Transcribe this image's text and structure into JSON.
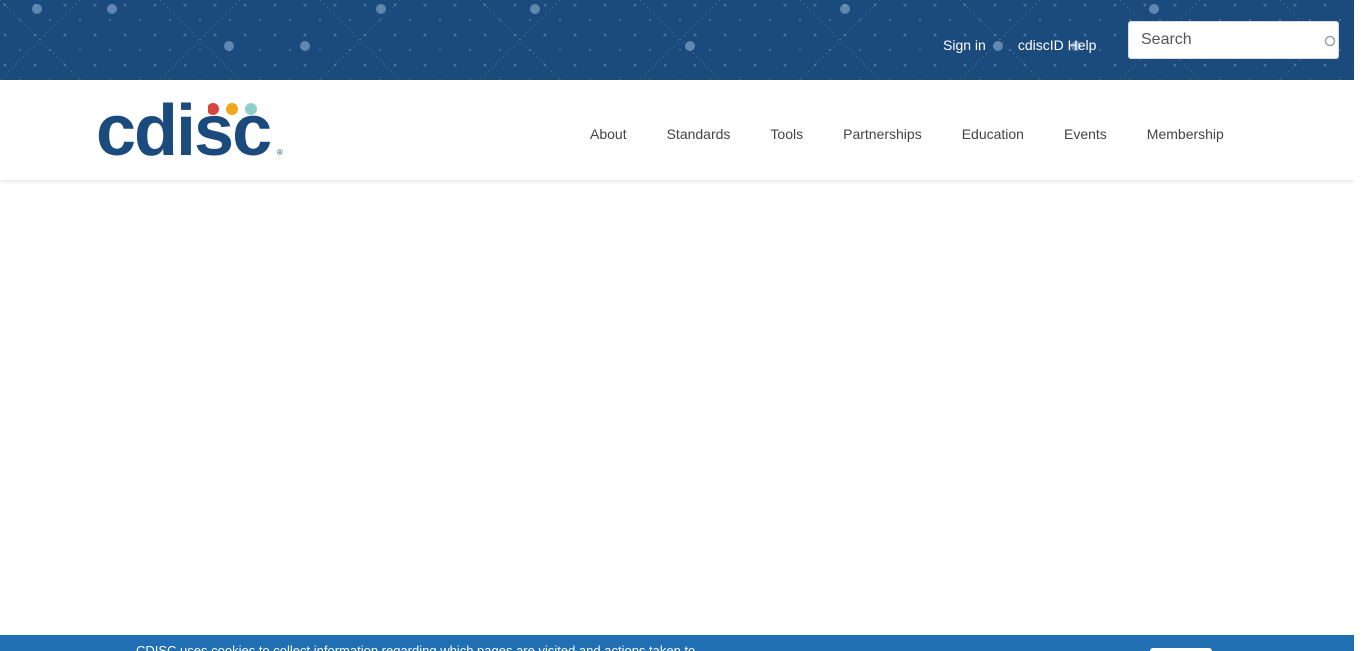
{
  "utility": {
    "sign_in": "Sign in",
    "help": "cdiscID Help",
    "search_placeholder": "Search"
  },
  "logo": {
    "text": "cdisc",
    "registered": "®",
    "dot_colors": [
      "#d9453b",
      "#f0a71a",
      "#8fcfc9"
    ]
  },
  "nav": {
    "items": [
      "About",
      "Standards",
      "Tools",
      "Partnerships",
      "Education",
      "Events",
      "Membership"
    ]
  },
  "footer": {
    "text": "CDISC uses cookies to collect information regarding which pages are visited and actions taken to"
  },
  "colors": {
    "brand_navy": "#1b4a7c",
    "footer_blue": "#1f6fb2"
  }
}
